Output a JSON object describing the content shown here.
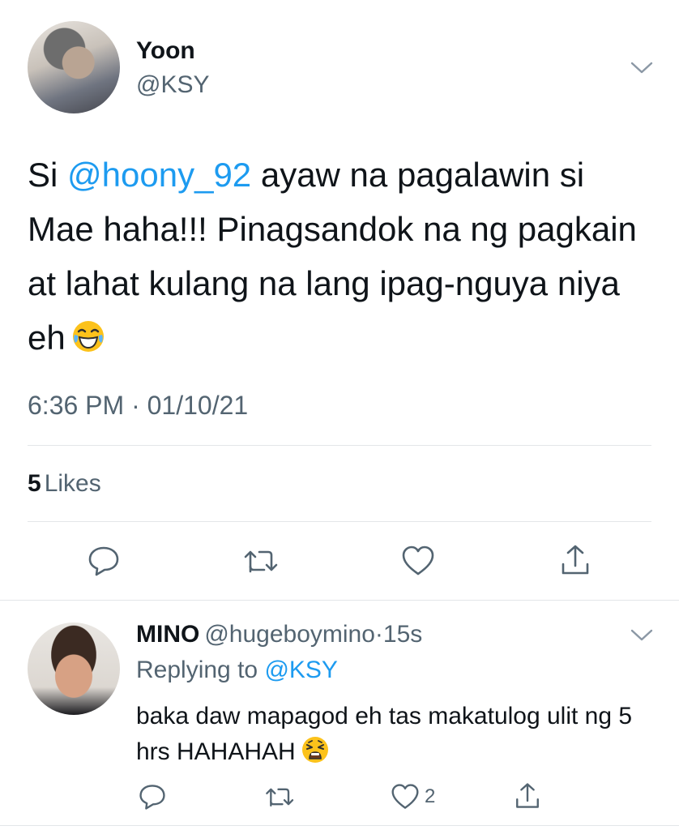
{
  "tweet": {
    "author_name": "Yoon",
    "author_handle": "@KSY",
    "text_part1": "Si ",
    "mention": "@hoony_92",
    "text_part2": " ayaw na pagalawin si Mae haha!!! Pinagsandok na ng pagkain at lahat kulang na lang ipag-nguya niya eh",
    "emoji": "face-with-tears-of-joy",
    "timestamp": "6:36 PM · 01/10/21",
    "likes_count": "5",
    "likes_label": "Likes"
  },
  "reply": {
    "author_name": "MINO",
    "author_handle": "@hugeboymino",
    "separator": "·",
    "time": "15s",
    "replying_label": "Replying to ",
    "replying_to": "@KSY",
    "text": "baka daw mapagod eh tas makatulog ulit ng 5 hrs HAHAHAH",
    "emoji": "weary-face",
    "like_count": "2"
  },
  "icons": {
    "reply": "comment-icon",
    "retweet": "retweet-icon",
    "like": "heart-icon",
    "share": "share-icon",
    "more": "chevron-down-icon"
  },
  "colors": {
    "accent": "#1d9bf0",
    "secondary_text": "#536471",
    "primary_text": "#0f1419",
    "divider": "#e3e6e9"
  }
}
